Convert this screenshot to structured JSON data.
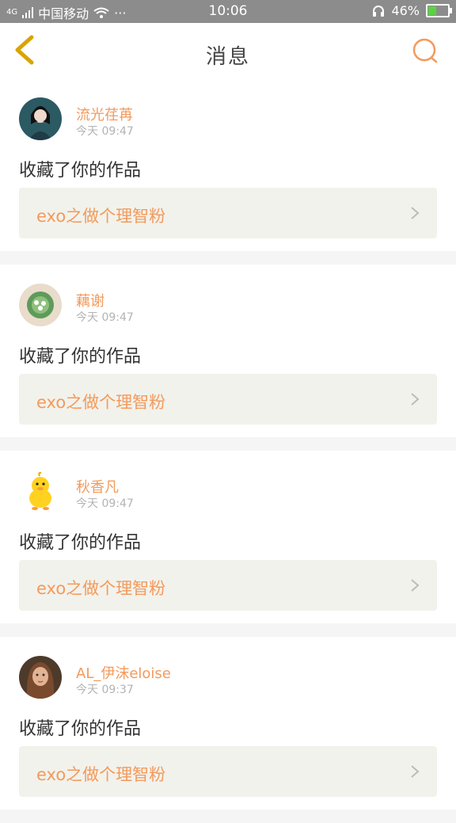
{
  "status": {
    "carrier_prefix": "4G",
    "carrier": "中国移动",
    "more": "···",
    "time": "10:06",
    "battery": "46%",
    "battery_level": 0.46
  },
  "header": {
    "title": "消息"
  },
  "notifications": [
    {
      "username": "流光荏苒",
      "time": "今天 09:47",
      "action": "收藏了你的作品",
      "work": "exo之做个理智粉"
    },
    {
      "username": "藕谢",
      "time": "今天 09:47",
      "action": "收藏了你的作品",
      "work": "exo之做个理智粉"
    },
    {
      "username": "秋香凡",
      "time": "今天 09:47",
      "action": "收藏了你的作品",
      "work": "exo之做个理智粉"
    },
    {
      "username": "AL_伊沫eloise",
      "time": "今天 09:37",
      "action": "收藏了你的作品",
      "work": "exo之做个理智粉"
    }
  ],
  "colors": {
    "accent": "#f39a5c",
    "back_arrow": "#d9a400",
    "card_link_bg": "#f2f2ec"
  }
}
